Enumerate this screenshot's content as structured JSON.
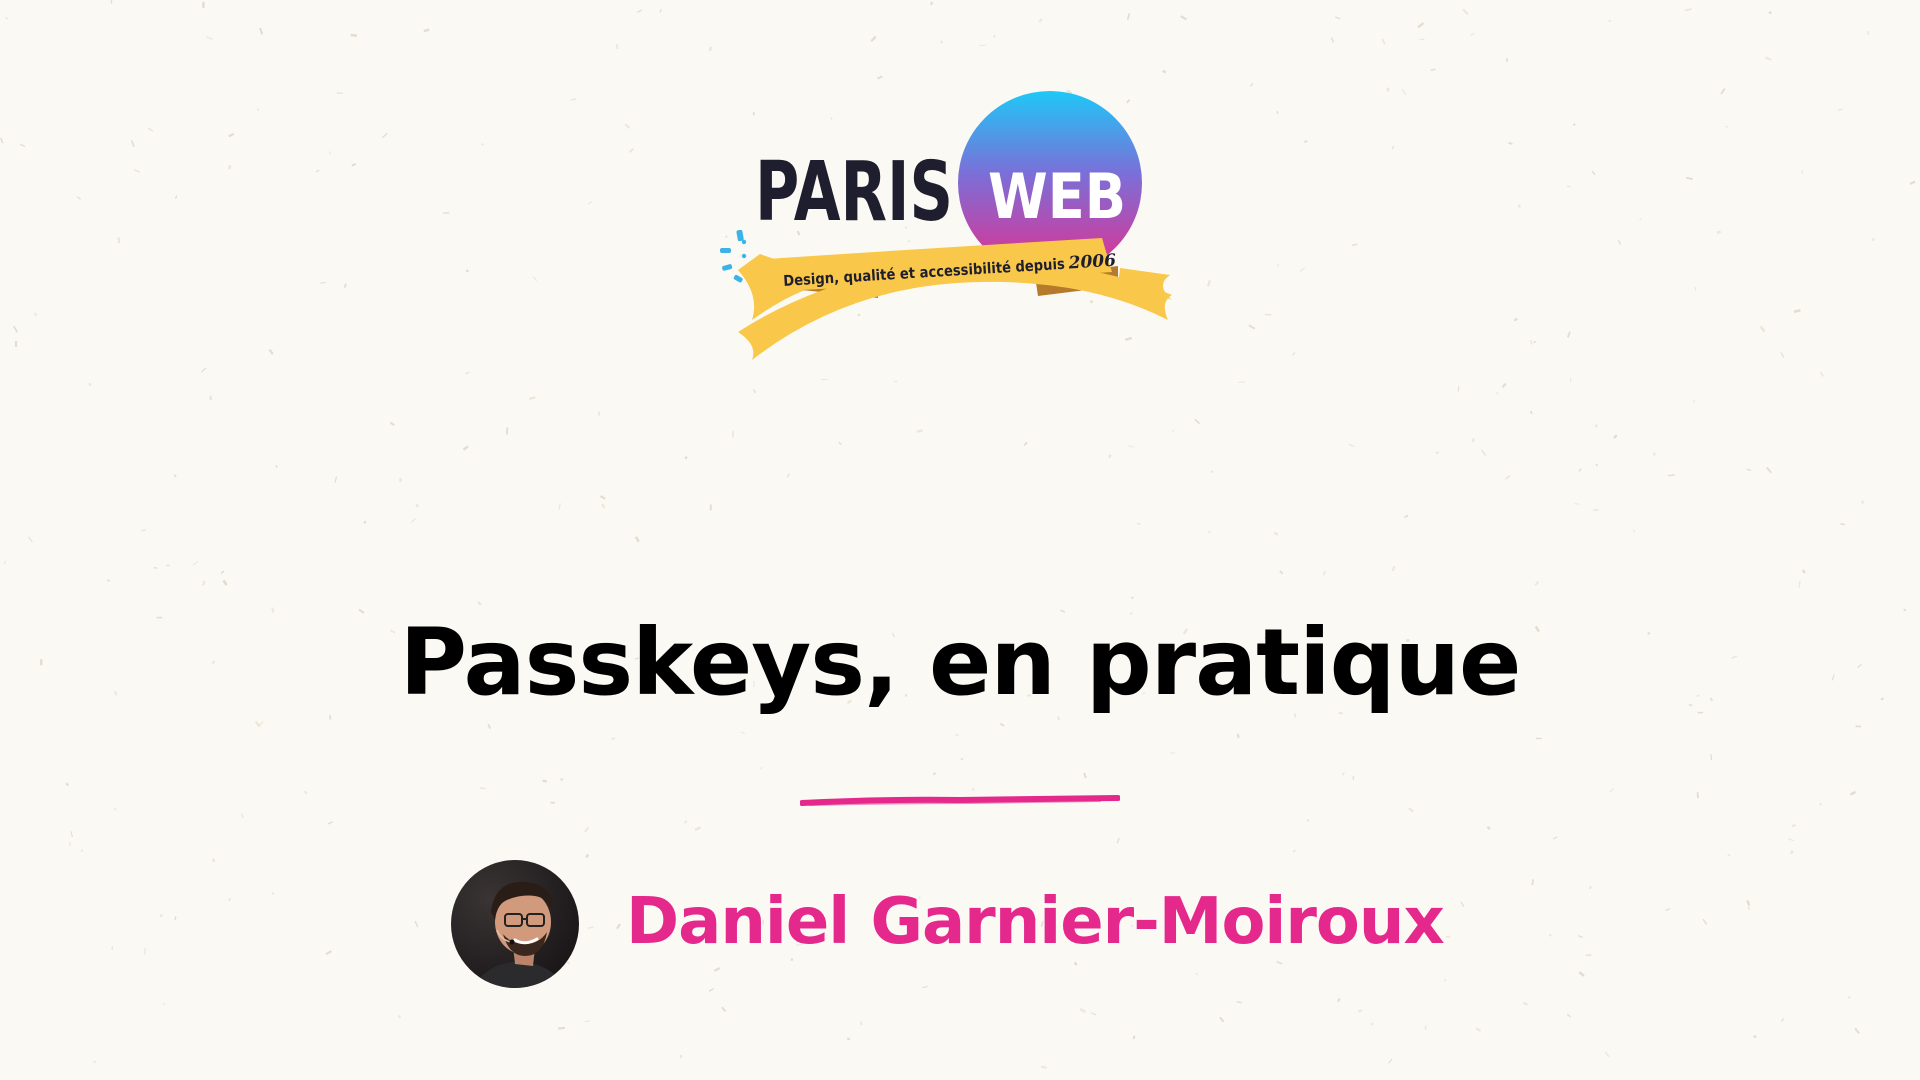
{
  "colors": {
    "background": "#fbf9f3",
    "title": "#000000",
    "accent": "#e5288c",
    "logo_text": "#1f1e2e",
    "ribbon": "#f9c84a",
    "ribbon_dark": "#b57a2c",
    "globe_top": "#1ec8f7",
    "globe_bottom": "#e52e8d",
    "sparkle": "#3bb3e6"
  },
  "logo": {
    "brand_left": "PARIS",
    "brand_right": "WEB",
    "tagline": "Design, qualité et accessibilité depuis",
    "tagline_year": "2006",
    "icon": "paris-web-logo"
  },
  "talk": {
    "title": "Passkeys, en pratique"
  },
  "speaker": {
    "name": "Daniel Garnier-Moiroux",
    "avatar_icon": "speaker-photo"
  }
}
